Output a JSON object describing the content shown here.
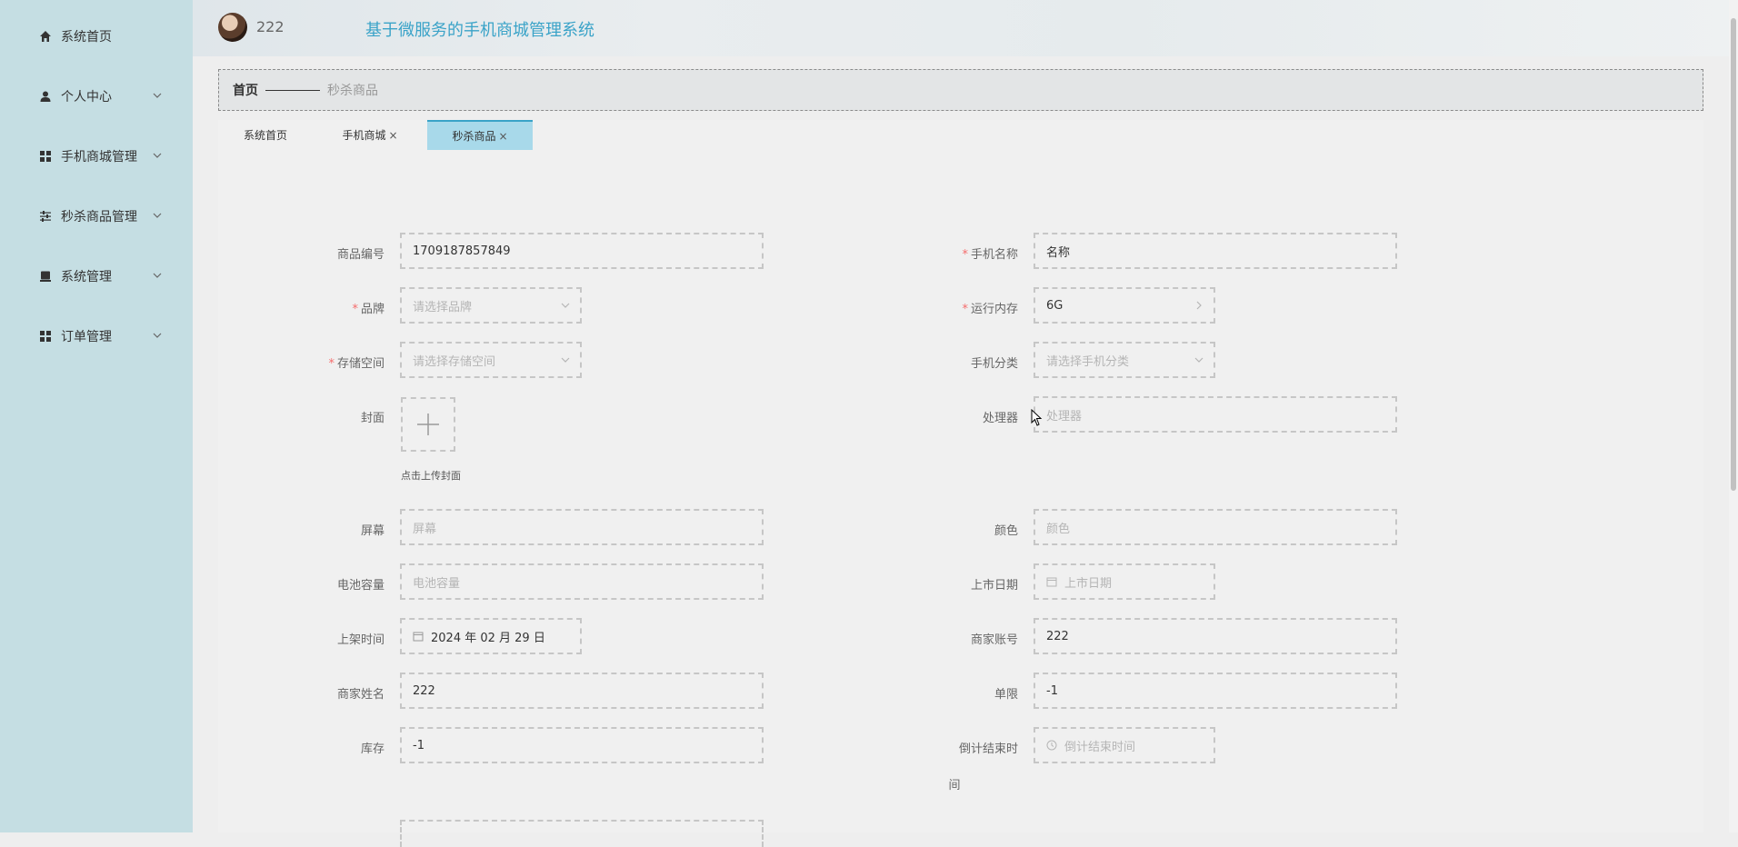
{
  "sidebar": {
    "items": [
      {
        "label": "系统首页",
        "icon": "home-icon"
      },
      {
        "label": "个人中心",
        "icon": "user-icon"
      },
      {
        "label": "手机商城管理",
        "icon": "grid-icon"
      },
      {
        "label": "秒杀商品管理",
        "icon": "sliders-icon"
      },
      {
        "label": "系统管理",
        "icon": "device-icon"
      },
      {
        "label": "订单管理",
        "icon": "grid-icon"
      }
    ]
  },
  "header": {
    "username": "222",
    "title": "基于微服务的手机商城管理系统"
  },
  "breadcrumb": {
    "home": "首页",
    "current": "秒杀商品"
  },
  "tabs": [
    {
      "label": "系统首页"
    },
    {
      "label": "手机商城",
      "close": "×"
    },
    {
      "label": "秒杀商品",
      "close": "×"
    }
  ],
  "form": {
    "product_no": {
      "label": "商品编号",
      "value": "1709187857849"
    },
    "phone_name": {
      "label": "手机名称",
      "value": "名称"
    },
    "brand": {
      "label": "品牌",
      "placeholder": "请选择品牌"
    },
    "ram": {
      "label": "运行内存",
      "value": "6G"
    },
    "storage": {
      "label": "存储空间",
      "placeholder": "请选择存储空间"
    },
    "category": {
      "label": "手机分类",
      "placeholder": "请选择手机分类"
    },
    "cover": {
      "label": "封面",
      "hint": "点击上传封面"
    },
    "processor": {
      "label": "处理器",
      "placeholder": "处理器"
    },
    "screen": {
      "label": "屏幕",
      "placeholder": "屏幕"
    },
    "color": {
      "label": "颜色",
      "placeholder": "颜色"
    },
    "battery": {
      "label": "电池容量",
      "placeholder": "电池容量"
    },
    "release_date": {
      "label": "上市日期",
      "placeholder": "上市日期"
    },
    "listing_time": {
      "label": "上架时间",
      "value": "2024 年 02 月 29 日"
    },
    "merchant_account": {
      "label": "商家账号",
      "value": "222"
    },
    "merchant_name": {
      "label": "商家姓名",
      "value": "222"
    },
    "limit": {
      "label": "单限",
      "value": "-1"
    },
    "stock": {
      "label": "库存",
      "value": "-1"
    },
    "countdown_end": {
      "label": "倒计结束时",
      "label_wrap": "间",
      "placeholder": "倒计结束时间"
    }
  },
  "colors": {
    "sidebar_bg": "#c5dee3",
    "accent": "#3aa3c8",
    "active_tab": "#a8d9ea",
    "required": "#f56c6c"
  }
}
